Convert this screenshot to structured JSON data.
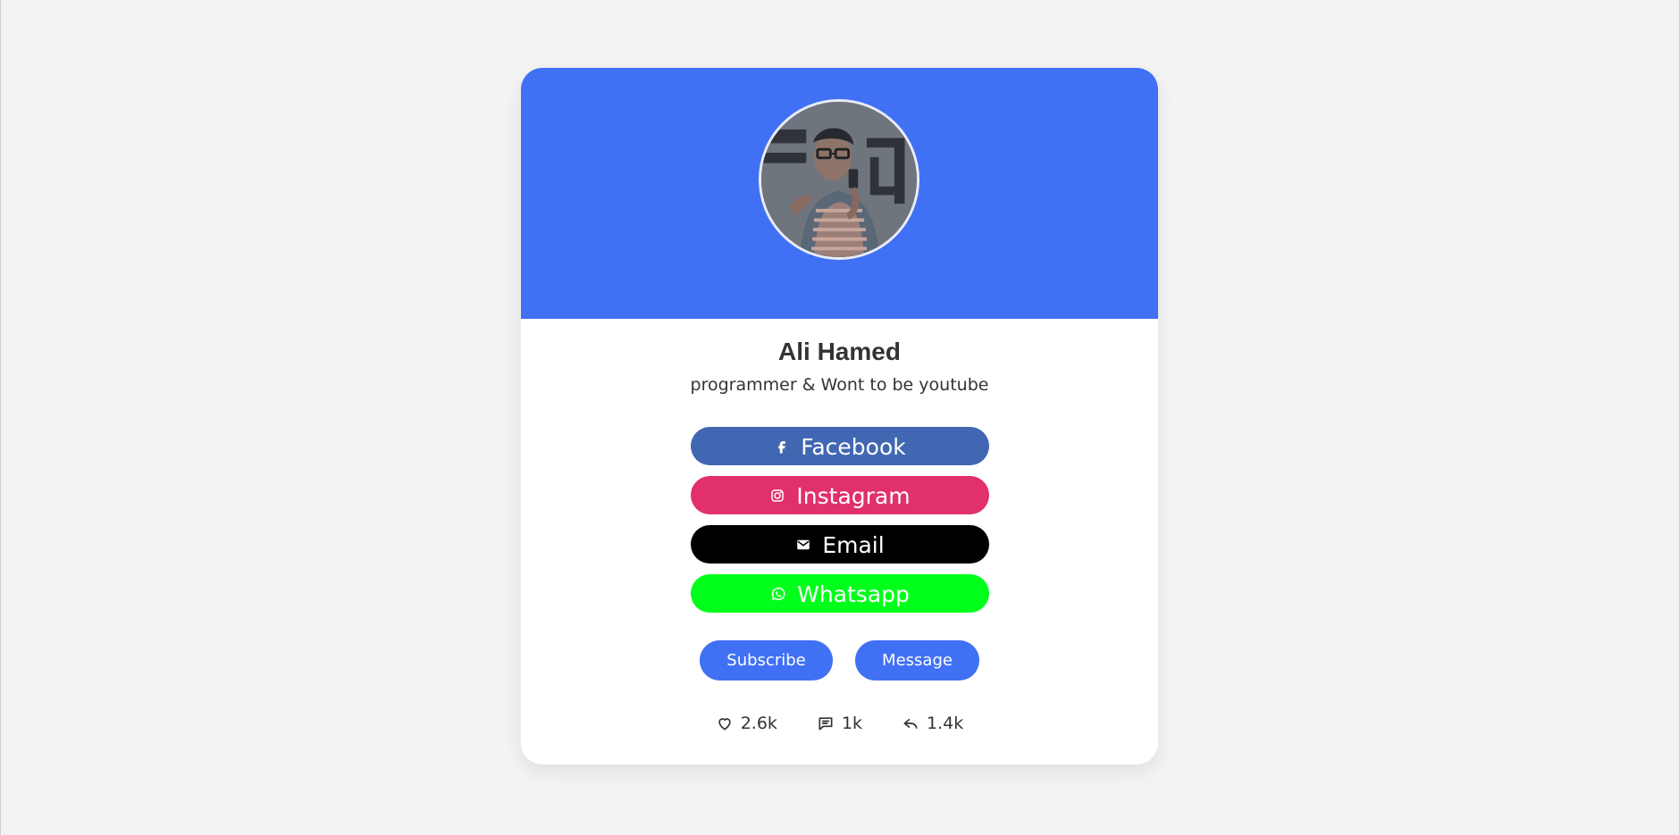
{
  "theme": {
    "page_background": "#f3f3f3",
    "card_background": "#ffffff",
    "header_color": "#4070f4",
    "primary_button_color": "#4070f4",
    "text_color": "#333333"
  },
  "profile": {
    "name": "Ali Hamed",
    "bio": "programmer & Wont to be youtube",
    "avatar_icon": "profile-photo"
  },
  "social_links": [
    {
      "label": "Facebook",
      "icon": "facebook-icon",
      "color": "#4267b2"
    },
    {
      "label": "Instagram",
      "icon": "instagram-icon",
      "color": "#e1306c"
    },
    {
      "label": "Email",
      "icon": "email-icon",
      "color": "#000000"
    },
    {
      "label": "Whatsapp",
      "icon": "whatsapp-icon",
      "color": "#00ff1a"
    }
  ],
  "actions": {
    "subscribe_label": "Subscribe",
    "message_label": "Message"
  },
  "stats": {
    "likes": "2.6k",
    "comments": "1k",
    "shares": "1.4k",
    "likes_icon": "heart-icon",
    "comments_icon": "comment-icon",
    "shares_icon": "reply-icon"
  }
}
